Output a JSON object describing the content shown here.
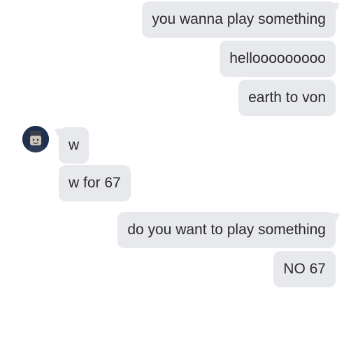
{
  "conversation": {
    "outgoing_group_1": [
      "you wanna play something",
      "hellooooooooo",
      "earth to von"
    ],
    "incoming": {
      "avatar_icon": "roblox-avatar-icon",
      "messages": [
        "w",
        "w for 67"
      ]
    },
    "outgoing_group_2": [
      "do you want to play something",
      "NO 67"
    ]
  },
  "colors": {
    "bubble": "#e8e9ec",
    "text": "#2b2b2b",
    "background": "#ffffff"
  }
}
